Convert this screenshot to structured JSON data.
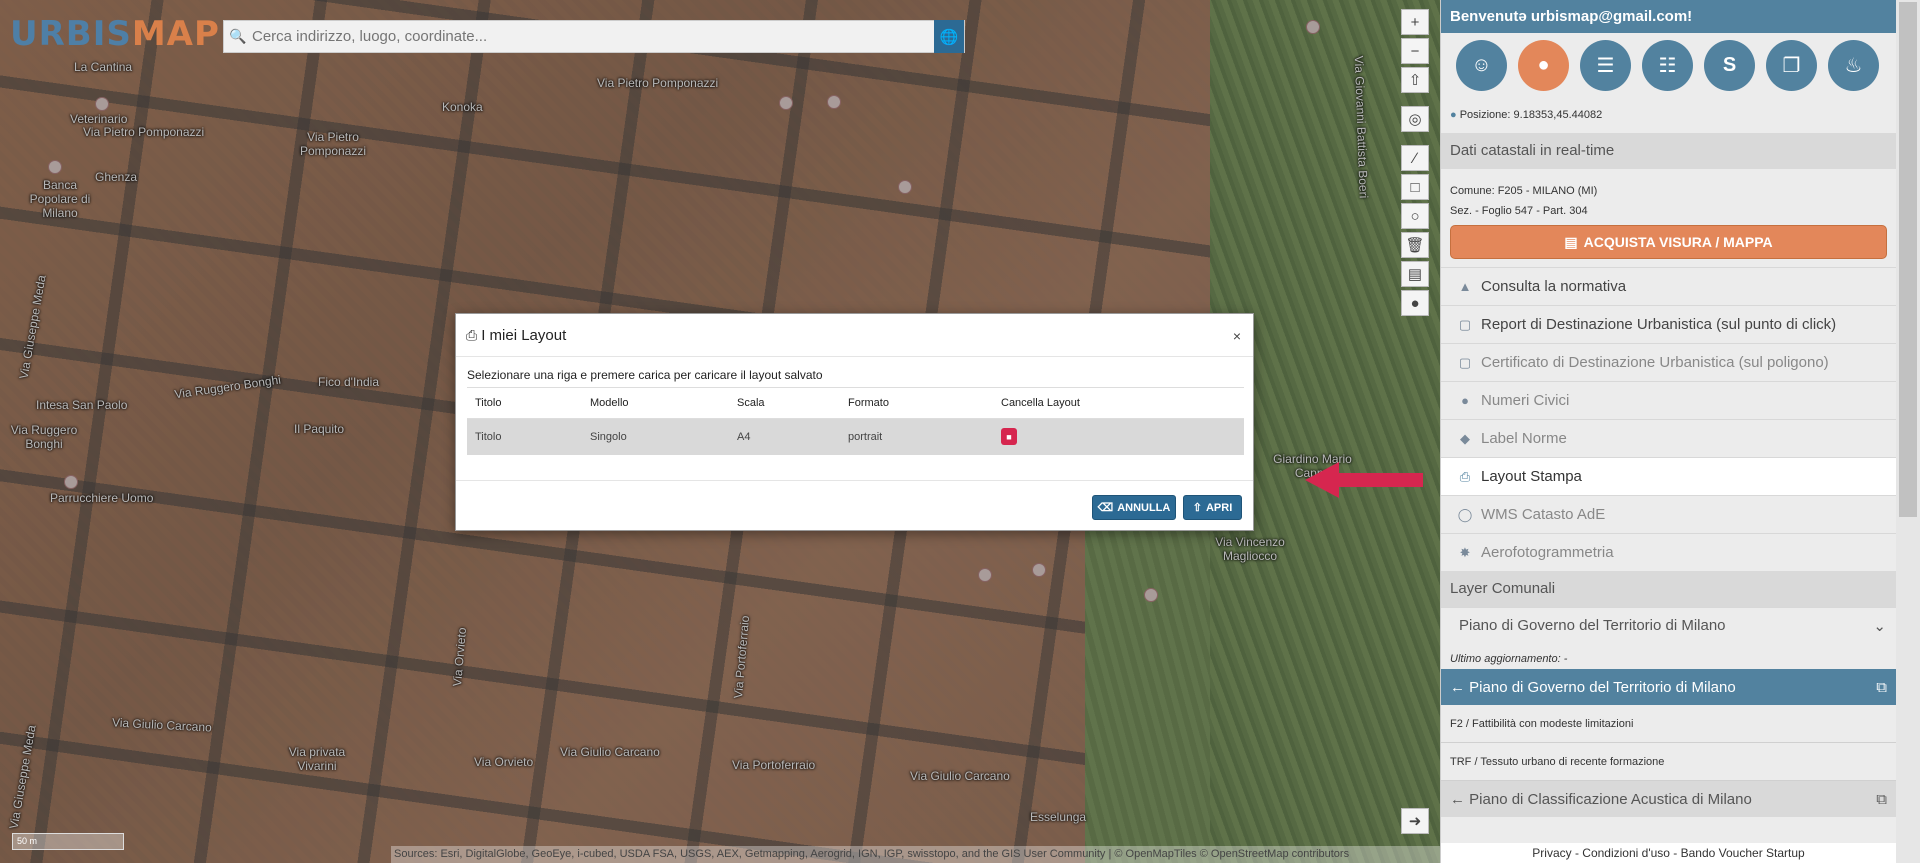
{
  "app": {
    "logo_part1": "URBIS",
    "logo_part2": "MAP"
  },
  "search": {
    "placeholder": "Cerca indirizzo, luogo, coordinate..."
  },
  "map": {
    "streets": [
      "La Cantina",
      "Via Pietro Pomponazzi",
      "Konoka",
      "Veterinario",
      "Via Pietro Pomponazzi",
      "Via Pietro Pomponazzi",
      "Banca Popolare di Milano",
      "Ghenza",
      "Via Giuseppe Meda",
      "Via Ruggero Bonghi",
      "Fico d'India",
      "Intesa San Paolo",
      "Via Ruggero Bonghi",
      "Il Paquito",
      "Parrucchiere Uomo",
      "Via Giovanni Battista Boeri",
      "Via Vincenzo Magliocco",
      "Giardino Mario Cappa",
      "Via Orvieto",
      "Via Portoferraio",
      "Via Giulio Carcano",
      "Via privata Vivarini",
      "Via Giulio Carcano",
      "Via Orvieto",
      "Via Portoferraio",
      "Via Giulio Carcano",
      "Esselunga",
      "Via Giuseppe Meda"
    ],
    "scale": "50 m",
    "attribution": "Sources: Esri, DigitalGlobe, GeoEye, i-cubed, USDA FSA, USGS, AEX, Getmapping, Aerogrid, IGN, IGP, swisstopo, and the GIS User Community | © OpenMapTiles © OpenStreetMap contributors",
    "toolbar": [
      "plus-icon",
      "minus-icon",
      "compass-icon",
      "locate-icon",
      "line-icon",
      "polygon-icon",
      "circle-icon",
      "trash-icon",
      "print-icon",
      "marker-icon"
    ],
    "zoom_in": "+",
    "zoom_out": "−",
    "next_arrow": "➜"
  },
  "modal": {
    "title": "I miei Layout",
    "instruction": "Selezionare una riga e premere carica per caricare il layout salvato",
    "columns": [
      "Titolo",
      "Modello",
      "Scala",
      "Formato",
      "Cancella Layout"
    ],
    "rows": [
      {
        "titolo": "Titolo",
        "modello": "Singolo",
        "scala": "A4",
        "formato": "portrait"
      }
    ],
    "cancel_label": "ANNULLA",
    "open_label": "APRI",
    "close_label": "×"
  },
  "sidebar": {
    "welcome": "Benvenutə urbismap@gmail.com!",
    "icons": [
      "user-icon",
      "map-pin-icon",
      "layers-icon",
      "contacts-icon",
      "currency-icon",
      "windows-icon",
      "bell-icon"
    ],
    "position": "Posizione: 9.18353,45.44082",
    "catasto_title": "Dati catastali in real-time",
    "comune": "Comune: F205 - MILANO (MI)",
    "foglio": "Sez. - Foglio 547 - Part. 304",
    "buy_label": "ACQUISTA VISURA / MAPPA",
    "menu": [
      {
        "label": "Consulta la normativa",
        "icon": "graduation-cap-icon"
      },
      {
        "label": "Report di Destinazione Urbanistica (sul punto di click)",
        "icon": "file-icon"
      },
      {
        "label": "Certificato di Destinazione Urbanistica (sul poligono)",
        "icon": "file-icon"
      },
      {
        "label": "Numeri Civici",
        "icon": "pin-icon"
      },
      {
        "label": "Label Norme",
        "icon": "tag-icon"
      },
      {
        "label": "Layout Stampa",
        "icon": "print-icon"
      },
      {
        "label": "WMS Catasto AdE",
        "icon": "globe-icon"
      },
      {
        "label": "Aerofotogrammetria",
        "icon": "drone-icon"
      }
    ],
    "layer_title": "Layer Comunali",
    "layer_select": "Piano di Governo del Territorio di Milano",
    "updated": "Ultimo aggiornamento: -",
    "pgt_title": "Piano di Governo del Territorio di Milano",
    "rules": [
      "F2 / Fattibilità con modeste limitazioni",
      "TRF / Tessuto urbano di recente formazione"
    ],
    "acoustic_title": "Piano di Classificazione Acustica di Milano",
    "footer": "Privacy - Condizioni d'uso - Bando Voucher Startup"
  },
  "colors": {
    "primary": "#52829f",
    "accent": "#e3875a",
    "danger": "#d6264f",
    "arrow": "#d6264f"
  }
}
